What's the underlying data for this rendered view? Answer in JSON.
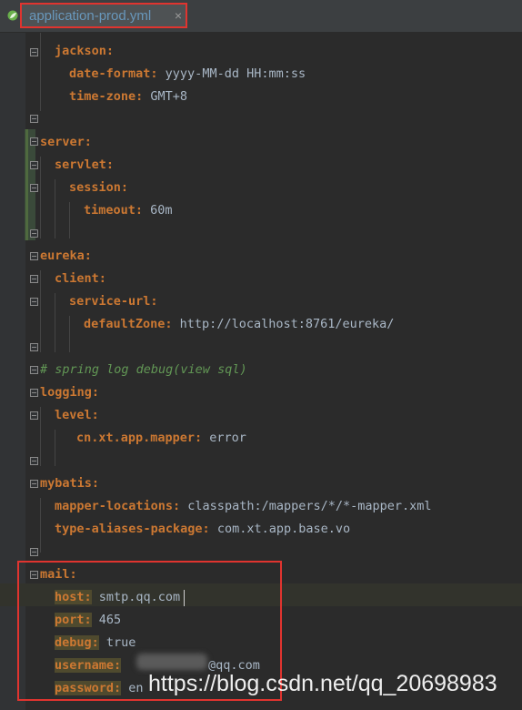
{
  "tab": {
    "title": "application-prod.yml",
    "close": "×",
    "icon": "spring-leaf-icon"
  },
  "lines": {
    "jackson": "jackson:",
    "date_format_key": "date-format:",
    "date_format_val": " yyyy-MM-dd HH:mm:ss",
    "time_zone_key": "time-zone:",
    "time_zone_val": " GMT+8",
    "server": "server:",
    "servlet": "servlet:",
    "session": "session:",
    "timeout_key": "timeout:",
    "timeout_val": " 60m",
    "eureka": "eureka:",
    "client": "client:",
    "service_url": "service-url:",
    "default_zone_key": "defaultZone:",
    "default_zone_val": " http://localhost:8761/eureka/",
    "comment": "# spring log debug(view sql)",
    "logging": "logging:",
    "level": "level:",
    "mapper_level_key": "cn.xt.app.mapper:",
    "mapper_level_val": " error",
    "mybatis": "mybatis:",
    "mapper_locations_key": "mapper-locations:",
    "mapper_locations_val": " classpath:/mappers/*/*-mapper.xml",
    "aliases_key": "type-aliases-package:",
    "aliases_val": " com.xt.app.base.vo",
    "mail": "mail:",
    "host_key": "host:",
    "host_val": " smtp.qq.com",
    "port_key": "port:",
    "port_val": " 465",
    "debug_key": "debug:",
    "debug_val": " true",
    "username_key": "username:",
    "username_val": "@qq.com",
    "password_key": "password:",
    "password_val": " en"
  },
  "watermark": "https://blog.csdn.net/qq_20698983",
  "colors": {
    "background": "#2b2b2b",
    "key": "#cc7832",
    "comment": "#629755",
    "highlight": "#e0342f"
  }
}
